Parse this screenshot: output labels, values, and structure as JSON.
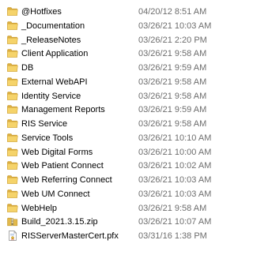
{
  "files": [
    {
      "name": "@Hotfixes",
      "date": "04/20/12 8:51 AM",
      "icon": "folder-icon"
    },
    {
      "name": "_Documentation",
      "date": "03/26/21 10:03 AM",
      "icon": "folder-icon"
    },
    {
      "name": "_ReleaseNotes",
      "date": "03/26/21 2:20 PM",
      "icon": "folder-icon"
    },
    {
      "name": "Client Application",
      "date": "03/26/21 9:58 AM",
      "icon": "folder-icon"
    },
    {
      "name": "DB",
      "date": "03/26/21 9:59 AM",
      "icon": "folder-icon"
    },
    {
      "name": "External WebAPI",
      "date": "03/26/21 9:58 AM",
      "icon": "folder-icon"
    },
    {
      "name": "Identity Service",
      "date": "03/26/21 9:58 AM",
      "icon": "folder-icon"
    },
    {
      "name": "Management Reports",
      "date": "03/26/21 9:59 AM",
      "icon": "folder-icon"
    },
    {
      "name": "RIS Service",
      "date": "03/26/21 9:58 AM",
      "icon": "folder-icon"
    },
    {
      "name": "Service Tools",
      "date": "03/26/21 10:10 AM",
      "icon": "folder-icon"
    },
    {
      "name": "Web Digital Forms",
      "date": "03/26/21 10:00 AM",
      "icon": "folder-icon"
    },
    {
      "name": "Web Patient Connect",
      "date": "03/26/21 10:02 AM",
      "icon": "folder-icon"
    },
    {
      "name": "Web Referring Connect",
      "date": "03/26/21 10:03 AM",
      "icon": "folder-icon"
    },
    {
      "name": "Web UM Connect",
      "date": "03/26/21 10:03 AM",
      "icon": "folder-icon"
    },
    {
      "name": "WebHelp",
      "date": "03/26/21 9:58 AM",
      "icon": "folder-icon"
    },
    {
      "name": "Build_2021.3.15.zip",
      "date": "03/26/21 10:07 AM",
      "icon": "zip-file-icon"
    },
    {
      "name": "RISServerMasterCert.pfx",
      "date": "03/31/16 1:38 PM",
      "icon": "certificate-file-icon"
    }
  ],
  "colors": {
    "name_text": "#000000",
    "date_text": "#6d6d6d",
    "folder": "#f5d36a",
    "folder_dark": "#dcae3f"
  }
}
